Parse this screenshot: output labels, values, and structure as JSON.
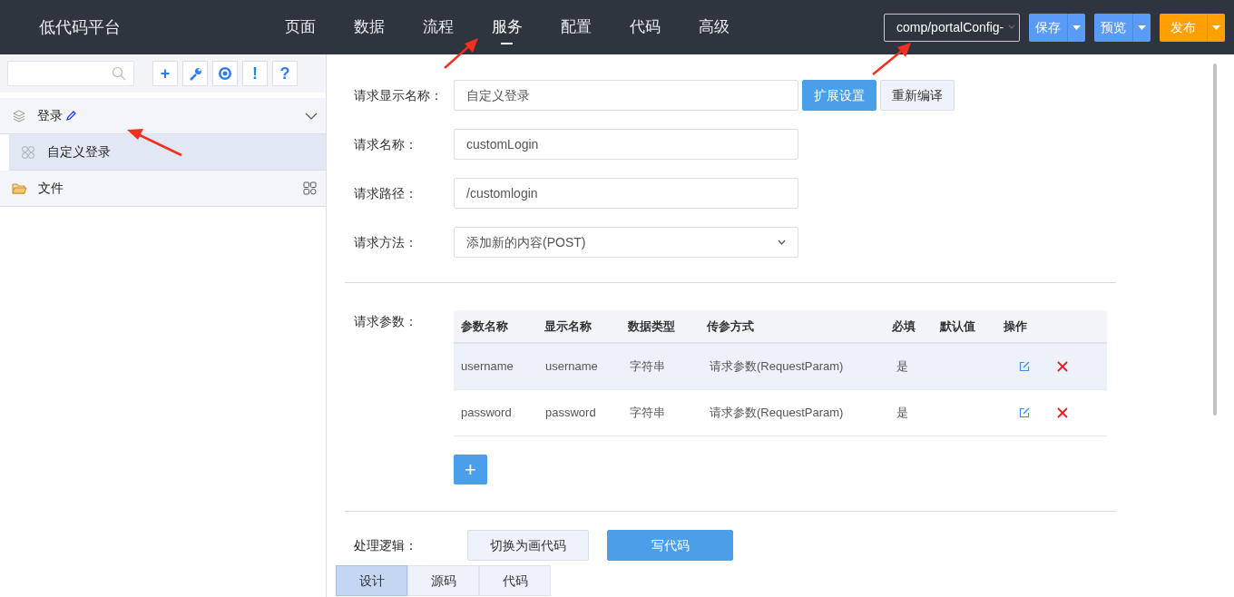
{
  "app": {
    "title": "低代码平台"
  },
  "nav": [
    {
      "label": "页面",
      "selected": false
    },
    {
      "label": "数据",
      "selected": false
    },
    {
      "label": "流程",
      "selected": false
    },
    {
      "label": "服务",
      "selected": true
    },
    {
      "label": "配置",
      "selected": false
    },
    {
      "label": "代码",
      "selected": false
    },
    {
      "label": "高级",
      "selected": false
    }
  ],
  "path_select": {
    "value": "comp/portalConfig-"
  },
  "header_buttons": [
    {
      "label": "保存",
      "kind": "blue"
    },
    {
      "label": "预览",
      "kind": "blue"
    },
    {
      "label": "发布",
      "kind": "orange"
    }
  ],
  "sidebar": {
    "toolbar": [
      "+",
      "!",
      "?"
    ],
    "tree": [
      {
        "label": "登录",
        "kind": "group",
        "expanded": true,
        "children": [
          {
            "label": "自定义登录",
            "selected": true
          }
        ]
      },
      {
        "label": "文件",
        "kind": "folder"
      }
    ]
  },
  "form": {
    "fields": [
      {
        "label": "请求显示名称：",
        "kind": "input",
        "value": "自定义登录"
      },
      {
        "label": "请求名称：",
        "kind": "input",
        "value": "customLogin"
      },
      {
        "label": "请求路径：",
        "kind": "input",
        "value": "/customlogin"
      },
      {
        "label": "请求方法：",
        "kind": "select",
        "value": "添加新的内容(POST)"
      }
    ],
    "field_buttons": [
      {
        "label": "扩展设置",
        "kind": "primary"
      },
      {
        "label": "重新编译",
        "kind": "secondary"
      }
    ],
    "params_label": "请求参数：",
    "params": {
      "columns": [
        "参数名称",
        "显示名称",
        "数据类型",
        "传参方式",
        "必填",
        "默认值",
        "操作"
      ],
      "rows": [
        {
          "cells": [
            "username",
            "username",
            "字符串",
            "请求参数(RequestParam)",
            "是",
            ""
          ],
          "selected": true
        },
        {
          "cells": [
            "password",
            "password",
            "字符串",
            "请求参数(RequestParam)",
            "是",
            ""
          ],
          "selected": false
        }
      ],
      "add_button": "+"
    },
    "logic_label": "处理逻辑：",
    "logic_buttons": [
      {
        "label": "切换为画代码",
        "kind": "secondary"
      },
      {
        "label": "写代码",
        "kind": "primary"
      }
    ],
    "tabs": [
      {
        "label": "设计",
        "selected": true
      },
      {
        "label": "源码",
        "selected": false
      },
      {
        "label": "代码",
        "selected": false
      }
    ]
  }
}
